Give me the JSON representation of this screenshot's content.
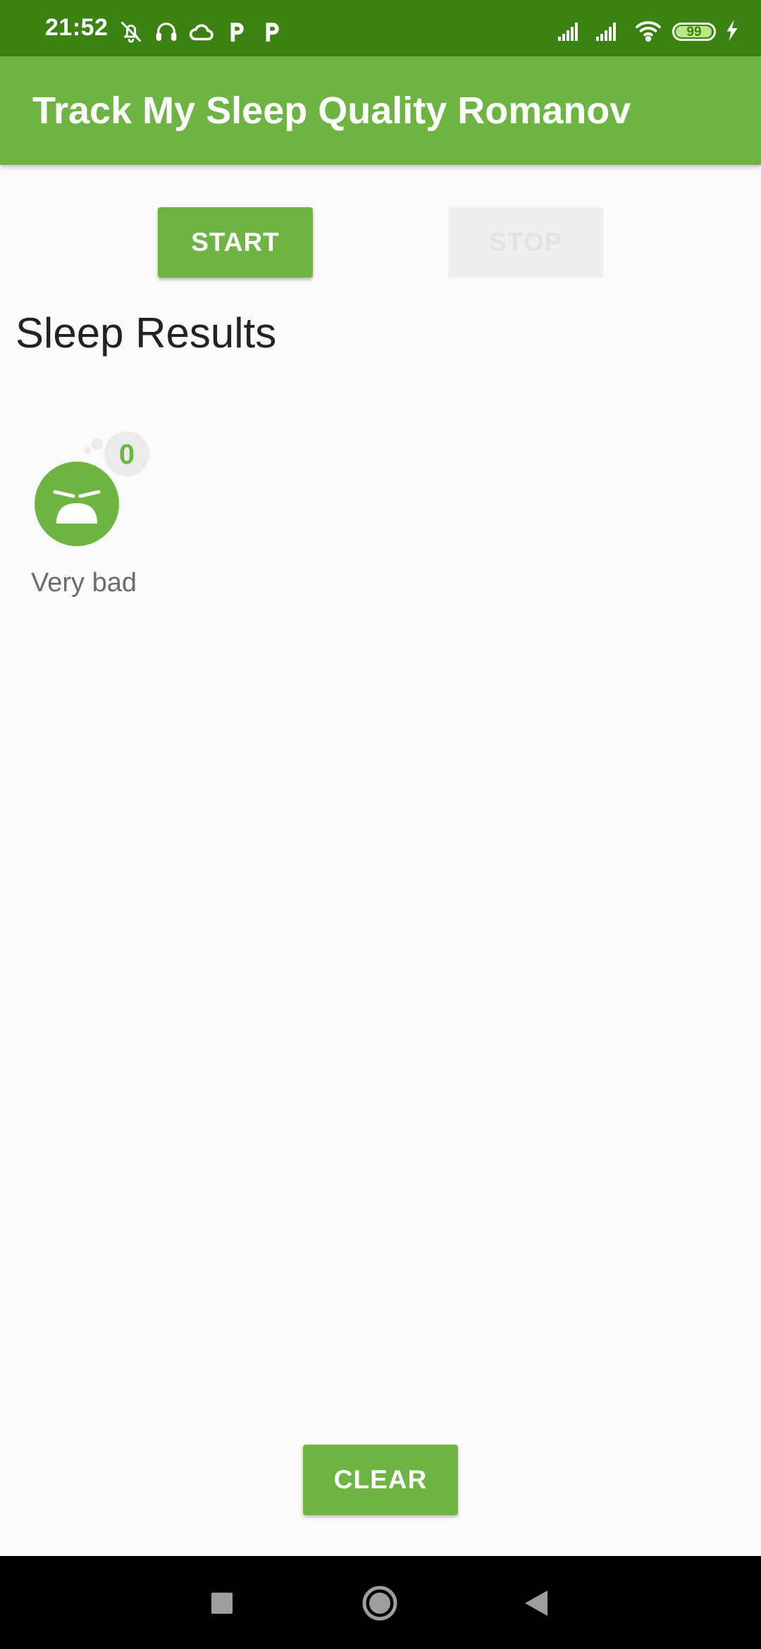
{
  "status_bar": {
    "time": "21:52",
    "left_icons": [
      "bell-off-icon",
      "headphones-icon",
      "cloud-icon",
      "p-app-icon",
      "p-app-icon"
    ],
    "right_icons": [
      "signal-icon",
      "signal-icon",
      "wifi-icon",
      "battery-icon",
      "charging-icon"
    ],
    "battery_level": "99",
    "battery_fraction": 0.99
  },
  "app_bar": {
    "title": "Track My Sleep Quality Romanov"
  },
  "buttons": {
    "start_label": "START",
    "stop_label": "STOP",
    "clear_label": "CLEAR"
  },
  "results": {
    "heading": "Sleep Results",
    "items": [
      {
        "icon": "very-bad-sleep-face-icon",
        "badge": "0",
        "label": "Very bad"
      }
    ]
  },
  "nav_bar": {
    "icons": [
      "recents-icon",
      "home-icon",
      "back-icon"
    ]
  },
  "colors": {
    "status_bar": "#3a8212",
    "primary": "#6db443",
    "background": "#fafafa",
    "text_dark": "#222222",
    "text_muted": "#6b6b6b"
  }
}
